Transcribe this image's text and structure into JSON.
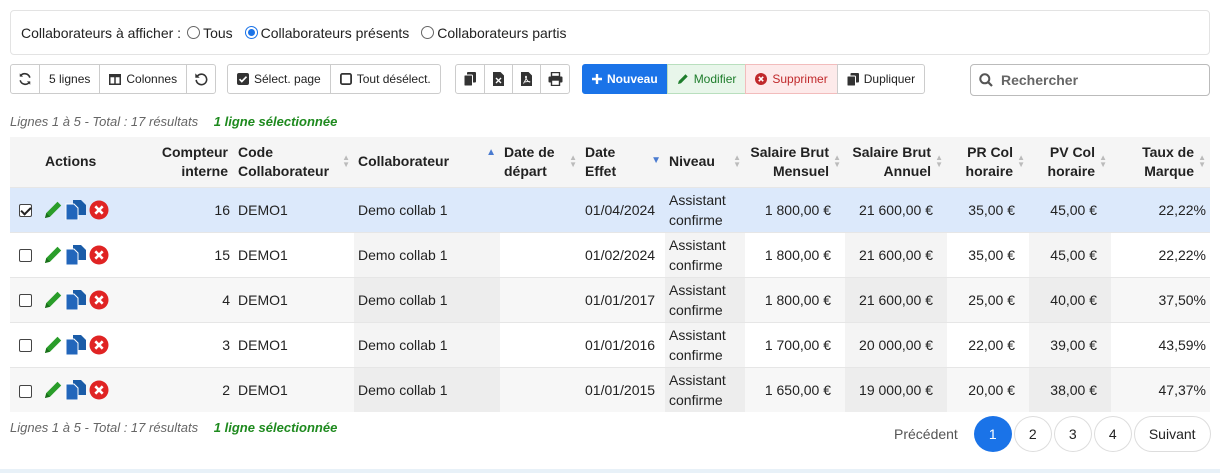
{
  "filter": {
    "label": "Collaborateurs à afficher :",
    "options": [
      {
        "label": "Tous",
        "checked": false
      },
      {
        "label": "Collaborateurs présents",
        "checked": true
      },
      {
        "label": "Collaborateurs partis",
        "checked": false
      }
    ]
  },
  "toolbar": {
    "refresh_icon": "refresh-icon",
    "rows_label": "5 lignes",
    "columns_label": "Colonnes",
    "reset_icon": "undo-icon",
    "select_page_label": "Sélect. page",
    "deselect_all_label": "Tout désélect.",
    "copy_icon": "copy-icon",
    "excel_icon": "excel-icon",
    "pdf_icon": "pdf-icon",
    "print_icon": "print-icon",
    "new_label": "Nouveau",
    "edit_label": "Modifier",
    "delete_label": "Supprimer",
    "duplicate_label": "Dupliquer"
  },
  "search": {
    "placeholder": "Rechercher"
  },
  "info": {
    "text": "Lignes 1 à 5 - Total : 17 résultats",
    "selected": "1 ligne sélectionnée"
  },
  "table": {
    "headers": {
      "actions": "Actions",
      "compteur": [
        "Compteur",
        "interne"
      ],
      "code": [
        "Code",
        "Collaborateur"
      ],
      "collaborateur": "Collaborateur",
      "date_depart": [
        "Date de",
        "départ"
      ],
      "date_effet": [
        "Date",
        "Effet"
      ],
      "niveau": "Niveau",
      "salaire_mensuel": [
        "Salaire Brut",
        "Mensuel"
      ],
      "salaire_annuel": [
        "Salaire Brut",
        "Annuel"
      ],
      "pr_col": [
        "PR Col",
        "horaire"
      ],
      "pv_col": [
        "PV Col",
        "horaire"
      ],
      "taux": [
        "Taux de",
        "Marque"
      ]
    },
    "rows": [
      {
        "selected": true,
        "compteur": "16",
        "code": "DEMO1",
        "collaborateur": "Demo collab 1",
        "date_depart": "",
        "date_effet": "01/04/2024",
        "niveau": [
          "Assistant",
          "confirme"
        ],
        "salaire_mensuel": "1 800,00 €",
        "salaire_annuel": "21 600,00 €",
        "pr_col": "35,00 €",
        "pv_col": "45,00 €",
        "taux": "22,22%"
      },
      {
        "selected": false,
        "compteur": "15",
        "code": "DEMO1",
        "collaborateur": "Demo collab 1",
        "date_depart": "",
        "date_effet": "01/02/2024",
        "niveau": [
          "Assistant",
          "confirme"
        ],
        "salaire_mensuel": "1 800,00 €",
        "salaire_annuel": "21 600,00 €",
        "pr_col": "35,00 €",
        "pv_col": "45,00 €",
        "taux": "22,22%"
      },
      {
        "selected": false,
        "compteur": "4",
        "code": "DEMO1",
        "collaborateur": "Demo collab 1",
        "date_depart": "",
        "date_effet": "01/01/2017",
        "niveau": [
          "Assistant",
          "confirme"
        ],
        "salaire_mensuel": "1 800,00 €",
        "salaire_annuel": "21 600,00 €",
        "pr_col": "25,00 €",
        "pv_col": "40,00 €",
        "taux": "37,50%"
      },
      {
        "selected": false,
        "compteur": "3",
        "code": "DEMO1",
        "collaborateur": "Demo collab 1",
        "date_depart": "",
        "date_effet": "01/01/2016",
        "niveau": [
          "Assistant",
          "confirme"
        ],
        "salaire_mensuel": "1 700,00 €",
        "salaire_annuel": "20 000,00 €",
        "pr_col": "22,00 €",
        "pv_col": "39,00 €",
        "taux": "43,59%"
      },
      {
        "selected": false,
        "compteur": "2",
        "code": "DEMO1",
        "collaborateur": "Demo collab 1",
        "date_depart": "",
        "date_effet": "01/01/2015",
        "niveau": [
          "Assistant",
          "confirme"
        ],
        "salaire_mensuel": "1 650,00 €",
        "salaire_annuel": "19 000,00 €",
        "pr_col": "20,00 €",
        "pv_col": "38,00 €",
        "taux": "47,37%"
      }
    ]
  },
  "pagination": {
    "previous": "Précédent",
    "pages": [
      "1",
      "2",
      "3",
      "4"
    ],
    "active": "1",
    "next": "Suivant"
  },
  "colors": {
    "primary": "#1a73e8",
    "edit": "#1e7d2c",
    "delete": "#c0292b",
    "selected_row": "#dce9fb"
  }
}
